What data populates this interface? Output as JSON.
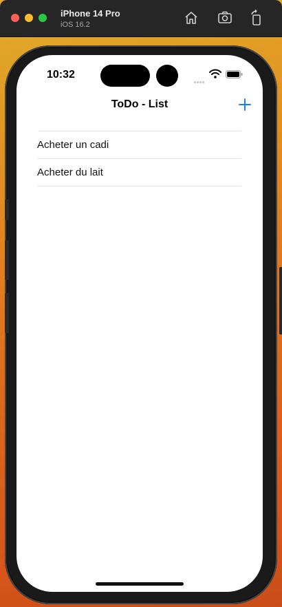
{
  "window": {
    "device_name": "iPhone 14 Pro",
    "os_version": "iOS 16.2",
    "toolbar_icons": [
      "home-icon",
      "screenshot-icon",
      "rotate-icon"
    ]
  },
  "status_bar": {
    "time": "10:32"
  },
  "nav": {
    "title": "ToDo - List",
    "add_icon": "plus-icon"
  },
  "todos": [
    {
      "label": "Acheter un cadi"
    },
    {
      "label": "Acheter du lait"
    }
  ],
  "colors": {
    "accent": "#0a84ff",
    "background": "#ffffff",
    "separator": "#e2e2e6"
  }
}
